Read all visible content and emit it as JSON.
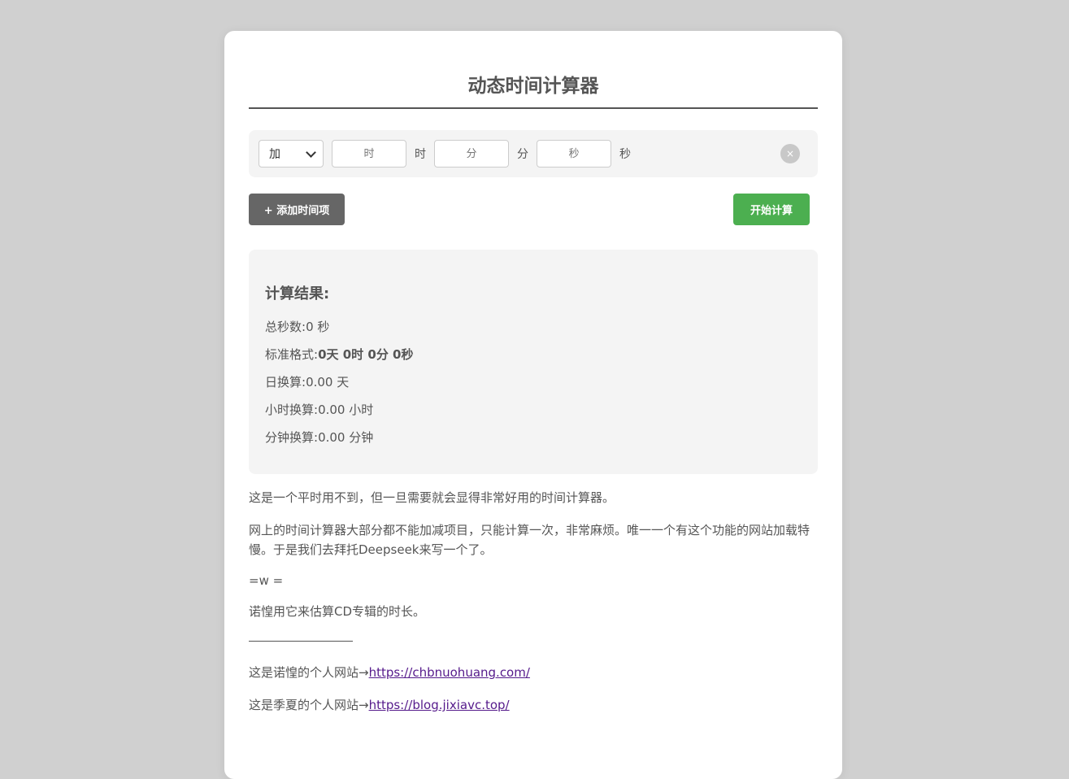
{
  "title": "动态时间计算器",
  "time_item": {
    "operation": "加",
    "hours_placeholder": "时",
    "hours_unit": "时",
    "minutes_placeholder": "分",
    "minutes_unit": "分",
    "seconds_placeholder": "秒",
    "seconds_unit": "秒",
    "remove_label": "×"
  },
  "buttons": {
    "add_label": "+ 添加时间项",
    "calc_label": "开始计算"
  },
  "result": {
    "title": "计算结果:",
    "total_seconds_label": "总秒数:",
    "total_seconds_value": "0 秒",
    "standard_label": "标准格式:",
    "standard_value": "0天 0时 0分 0秒",
    "days_label": "日换算:",
    "days_value": "0.00 天",
    "hours_label": "小时换算:",
    "hours_value": "0.00 小时",
    "minutes_label": "分钟换算:",
    "minutes_value": "0.00 分钟"
  },
  "description": {
    "p1": "这是一个平时用不到，但一旦需要就会显得非常好用的时间计算器。",
    "p2": "网上的时间计算器大部分都不能加减项目，只能计算一次，非常麻烦。唯一一个有这个功能的网站加载特慢。于是我们去拜托Deepseek来写一个了。",
    "p3": "=w =",
    "p4": "诺惶用它来估算CD专辑的时长。",
    "site1_prefix": "这是诺惶的个人网站→",
    "site1_link": "https://chbnuohuang.com/",
    "site2_prefix": "这是季夏的个人网站→",
    "site2_link": "https://blog.jixiavc.top/"
  }
}
